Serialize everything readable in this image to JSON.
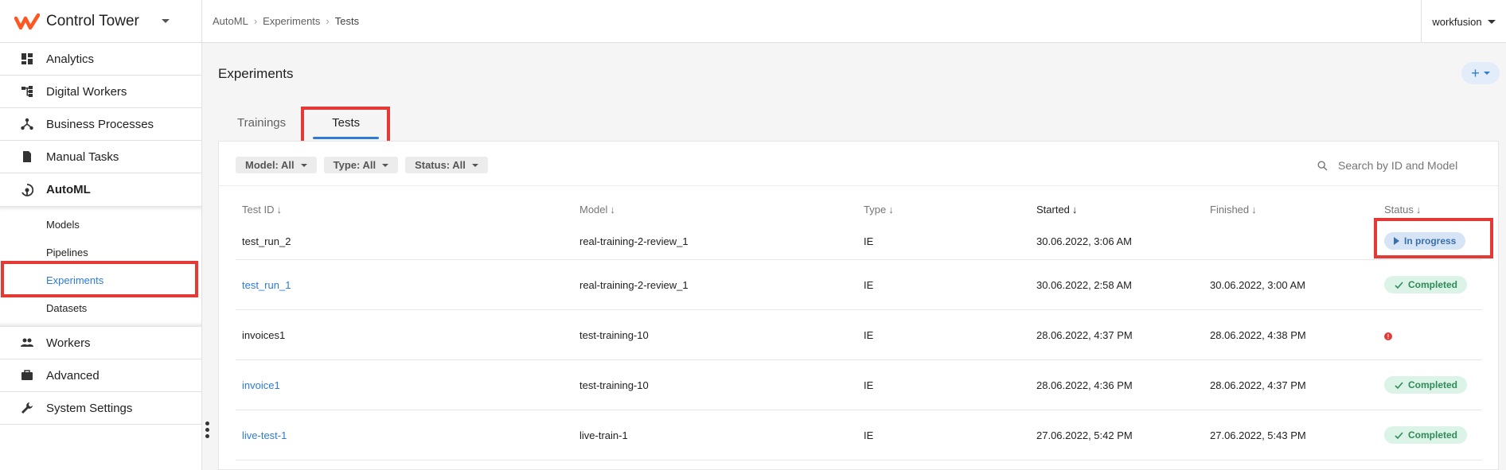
{
  "brand": {
    "name": "Control Tower"
  },
  "sidebar": {
    "items": [
      {
        "label": "Analytics",
        "icon": "dashboard-icon"
      },
      {
        "label": "Digital Workers",
        "icon": "hierarchy-icon"
      },
      {
        "label": "Business Processes",
        "icon": "process-icon"
      },
      {
        "label": "Manual Tasks",
        "icon": "document-icon"
      },
      {
        "label": "AutoML",
        "icon": "automl-icon",
        "active": true
      }
    ],
    "subitems": [
      {
        "label": "Models"
      },
      {
        "label": "Pipelines"
      },
      {
        "label": "Experiments",
        "active": true
      },
      {
        "label": "Datasets"
      }
    ],
    "bottom_items": [
      {
        "label": "Workers",
        "icon": "people-icon"
      },
      {
        "label": "Advanced",
        "icon": "briefcase-icon"
      },
      {
        "label": "System Settings",
        "icon": "wrench-icon"
      }
    ]
  },
  "breadcrumb": [
    "AutoML",
    "Experiments",
    "Tests"
  ],
  "account": {
    "name": "workfusion"
  },
  "page": {
    "title": "Experiments",
    "add_label": "+"
  },
  "tabs": [
    {
      "label": "Trainings"
    },
    {
      "label": "Tests",
      "active": true
    }
  ],
  "filters": [
    {
      "label": "Model: All"
    },
    {
      "label": "Type: All"
    },
    {
      "label": "Status: All"
    }
  ],
  "search": {
    "placeholder": "Search by ID and Model",
    "value": ""
  },
  "table": {
    "columns": [
      "Test ID",
      "Model",
      "Type",
      "Started",
      "Finished",
      "Status"
    ],
    "sorted_column": "Started",
    "rows": [
      {
        "id": "test_run_2",
        "id_link": false,
        "model": "real-training-2-review_1",
        "type": "IE",
        "started": "30.06.2022, 3:06 AM",
        "finished": "",
        "status": "In progress",
        "status_kind": "progress"
      },
      {
        "id": "test_run_1",
        "id_link": true,
        "model": "real-training-2-review_1",
        "type": "IE",
        "started": "30.06.2022, 2:58 AM",
        "finished": "30.06.2022, 3:00 AM",
        "status": "Completed",
        "status_kind": "done"
      },
      {
        "id": "invoices1",
        "id_link": false,
        "model": "test-training-10",
        "type": "IE",
        "started": "28.06.2022, 4:37 PM",
        "finished": "28.06.2022, 4:38 PM",
        "status": "!",
        "status_kind": "error"
      },
      {
        "id": "invoice1",
        "id_link": true,
        "model": "test-training-10",
        "type": "IE",
        "started": "28.06.2022, 4:36 PM",
        "finished": "28.06.2022, 4:37 PM",
        "status": "Completed",
        "status_kind": "done"
      },
      {
        "id": "live-test-1",
        "id_link": true,
        "model": "live-train-1",
        "type": "IE",
        "started": "27.06.2022, 5:42 PM",
        "finished": "27.06.2022, 5:43 PM",
        "status": "Completed",
        "status_kind": "done"
      }
    ]
  },
  "colors": {
    "accent": "#2d7bd6",
    "highlight": "#e53935",
    "brand": "#ff5722"
  }
}
